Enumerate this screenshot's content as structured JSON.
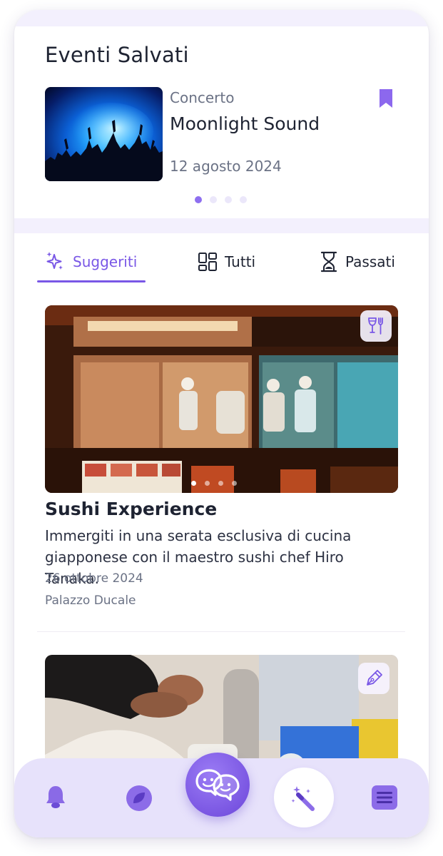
{
  "saved_events": {
    "title": "Eventi Salvati",
    "item": {
      "category": "Concerto",
      "name": "Moonlight Sound",
      "date": "12 agosto 2024",
      "bookmarked": true
    },
    "carousel_active_index": 0,
    "carousel_count": 4
  },
  "tabs": [
    {
      "label": "Suggeriti",
      "icon": "sparkles-icon",
      "active": true
    },
    {
      "label": "Tutti",
      "icon": "grid-icon",
      "active": false
    },
    {
      "label": "Passati",
      "icon": "hourglass-icon",
      "active": false
    }
  ],
  "events": [
    {
      "title": "Sushi Experience",
      "description": "Immergiti in una serata esclusiva di cucina giapponese con il maestro sushi chef Hiro Tanaka.",
      "date": "26 ottobre 2024",
      "place": "Palazzo Ducale",
      "category_icon": "wine-utensils-icon",
      "image_dots": 4,
      "image_active_index": 0
    },
    {
      "category_icon": "pen-nib-icon"
    }
  ],
  "bottom_nav": [
    {
      "icon": "bell-icon"
    },
    {
      "icon": "leaf-icon"
    },
    {
      "icon": "chat-faces-icon"
    },
    {
      "icon": "magic-wand-icon"
    },
    {
      "icon": "menu-icon"
    }
  ],
  "colors": {
    "accent": "#7957e6",
    "accent_light": "#e7e2fb",
    "band": "#f3f0fd",
    "text_muted": "#6b7285"
  }
}
